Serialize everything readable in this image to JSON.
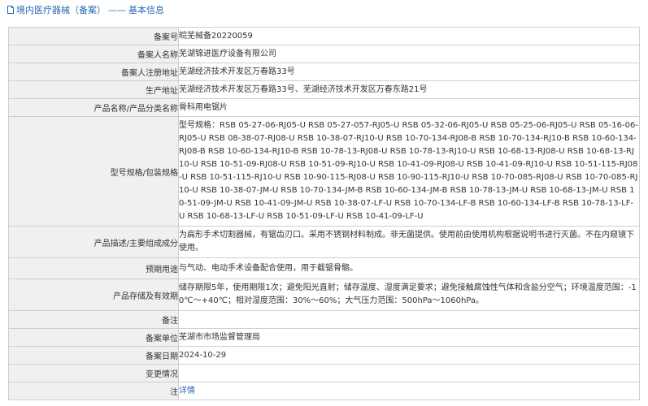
{
  "header": {
    "section": "境内医疗器械（备案）",
    "separator": "——",
    "subtitle": "基本信息"
  },
  "rows": [
    {
      "label": "备案号",
      "value": "皖芜械备20220059"
    },
    {
      "label": "备案人名称",
      "value": "芜湖锦进医疗设备有限公司"
    },
    {
      "label": "备案人注册地址",
      "value": "芜湖经济技术开发区万春路33号"
    },
    {
      "label": "生产地址",
      "value": "芜湖经济技术开发区万春路33号、芜湖经济技术开发区万春东路21号"
    },
    {
      "label": "产品名称/产品分类名称",
      "value": "骨科用电锯片"
    },
    {
      "label": "型号规格/包装规格",
      "value": "型号规格：RSB 05-27-06-RJ05-U RSB 05-27-057-RJ05-U RSB 05-32-06-RJ05-U RSB 05-25-06-RJ05-U RSB 05-16-06-RJ05-U RSB 08-38-07-RJ08-U RSB 10-38-07-RJ10-U RSB 10-70-134-RJ08-B RSB 10-70-134-RJ10-B RSB 10-60-134-RJ08-B RSB 10-60-134-RJ10-B RSB 10-78-13-RJ08-U RSB 10-78-13-RJ10-U RSB 10-68-13-RJ08-U RSB 10-68-13-RJ10-U RSB 10-51-09-RJ08-U RSB 10-51-09-RJ10-U RSB 10-41-09-RJ08-U RSB 10-41-09-RJ10-U RSB 10-51-115-RJ08-U RSB 10-51-115-RJ10-U RSB 10-90-115-RJ08-U RSB 10-90-115-RJ10-U RSB 10-70-085-RJ08-U RSB 10-70-085-RJ10-U RSB 10-38-07-JM-U RSB 10-70-134-JM-B RSB 10-60-134-JM-B RSB 10-78-13-JM-U RSB 10-68-13-JM-U RSB 10-51-09-JM-U RSB 10-41-09-JM-U RSB 10-38-07-LF-U RSB 10-70-134-LF-B RSB 10-60-134-LF-B RSB 10-78-13-LF-U RSB 10-68-13-LF-U RSB 10-51-09-LF-U RSB 10-41-09-LF-U"
    },
    {
      "label": "产品描述/主要组成成分",
      "value": "为扁形手术切割器械，有锯齿刃口。采用不锈钢材料制成。非无菌提供。使用前由使用机构根据说明书进行灭菌。不在内窥镜下使用。"
    },
    {
      "label": "预期用途",
      "value": "与气动、电动手术设备配合使用，用于截锯骨骼。"
    },
    {
      "label": "产品存储及有效期",
      "value": "储存期限5年，使用期限1次；避免阳光直射；储存温度、湿度满足要求；避免接触腐蚀性气体和含盐分空气；环境温度范围：-10℃～+40℃；相对湿度范围：30%～60%；大气压力范围：500hPa～1060hPa。"
    },
    {
      "label": "备注",
      "value": ""
    },
    {
      "label": "备案单位",
      "value": "芜湖市市场监督管理局"
    },
    {
      "label": "备案日期",
      "value": "2024-10-29"
    },
    {
      "label": "变更情况",
      "value": ""
    },
    {
      "label": "注",
      "value": "详情"
    }
  ]
}
